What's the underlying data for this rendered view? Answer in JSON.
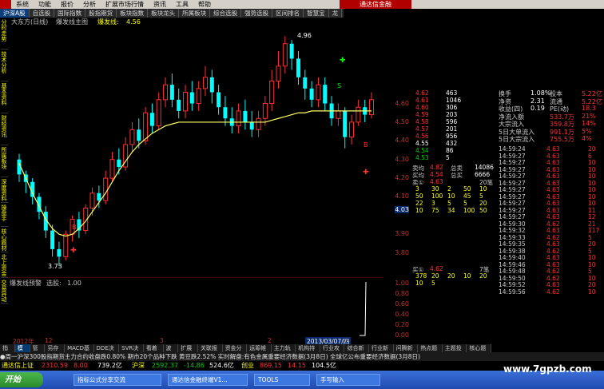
{
  "menubar": {
    "items": [
      "系统",
      "功能",
      "报价",
      "分析",
      "扩展市场行情",
      "资讯",
      "工具",
      "帮助"
    ]
  },
  "brand": "通达信金融",
  "toptabs": [
    "沪深A股",
    "自选股",
    "国际指数",
    "股指期货",
    "板块指数",
    "板块龙头",
    "所属板块",
    "综合选股",
    "强势选股",
    "区间排名",
    "智慧宝",
    "龙"
  ],
  "left_tabs": [
    "分时走势",
    "技术分析",
    "基本资料",
    "财经资讯",
    "所属板块",
    "深度资料",
    "操盘手",
    "核心题材",
    "北上资金",
    "交易异动"
  ],
  "chart": {
    "title": "大东方(日线)",
    "subtitle": "爆发线主图",
    "indicator_name": "爆发线:",
    "indicator_value": "4.56",
    "high_label": "4.96",
    "low_label": "3.73",
    "b_mark": "B",
    "s_mark": "S"
  },
  "chart_data": {
    "type": "candlestick",
    "ylim": [
      3.7,
      5.0
    ],
    "yticks": [
      "4.60",
      "4.50",
      "4.40",
      "4.30",
      "4.20",
      "4.10",
      "4.03",
      "3.90",
      "3.80"
    ],
    "indicator": {
      "label": "爆发线预警",
      "sub": "选股:",
      "value": "1.00",
      "ticks": [
        "1.00",
        "0.80",
        "0.60",
        "0.40",
        "0.20",
        "0.00"
      ]
    },
    "candles": [
      [
        4.3,
        4.22,
        4.33,
        4.18
      ],
      [
        4.22,
        4.18,
        4.24,
        4.12
      ],
      [
        4.18,
        4.1,
        4.2,
        4.06
      ],
      [
        4.1,
        4.02,
        4.12,
        3.98
      ],
      [
        4.02,
        3.92,
        4.05,
        3.88
      ],
      [
        3.92,
        3.82,
        3.95,
        3.78
      ],
      [
        3.82,
        3.78,
        3.86,
        3.73
      ],
      [
        3.78,
        3.9,
        3.92,
        3.76
      ],
      [
        3.9,
        3.98,
        4.0,
        3.86
      ],
      [
        3.98,
        3.92,
        4.02,
        3.88
      ],
      [
        3.92,
        4.04,
        4.06,
        3.9
      ],
      [
        4.04,
        4.12,
        4.15,
        4.0
      ],
      [
        4.12,
        4.08,
        4.16,
        4.04
      ],
      [
        4.08,
        4.2,
        4.24,
        4.06
      ],
      [
        4.2,
        4.3,
        4.34,
        4.18
      ],
      [
        4.3,
        4.26,
        4.36,
        4.22
      ],
      [
        4.26,
        4.38,
        4.42,
        4.24
      ],
      [
        4.38,
        4.46,
        4.5,
        4.34
      ],
      [
        4.46,
        4.4,
        4.52,
        4.36
      ],
      [
        4.4,
        4.55,
        4.58,
        4.38
      ],
      [
        4.55,
        4.48,
        4.6,
        4.44
      ],
      [
        4.48,
        4.62,
        4.66,
        4.46
      ],
      [
        4.62,
        4.7,
        4.74,
        4.58
      ],
      [
        4.7,
        4.62,
        4.76,
        4.58
      ],
      [
        4.62,
        4.56,
        4.68,
        4.52
      ],
      [
        4.56,
        4.66,
        4.7,
        4.52
      ],
      [
        4.66,
        4.6,
        4.72,
        4.56
      ],
      [
        4.6,
        4.68,
        4.72,
        4.56
      ],
      [
        4.68,
        4.74,
        4.8,
        4.64
      ],
      [
        4.74,
        4.66,
        4.78,
        4.6
      ],
      [
        4.66,
        4.58,
        4.7,
        4.54
      ],
      [
        4.58,
        4.52,
        4.64,
        4.48
      ],
      [
        4.52,
        4.48,
        4.58,
        4.44
      ],
      [
        4.48,
        4.56,
        4.6,
        4.44
      ],
      [
        4.56,
        4.5,
        4.62,
        4.46
      ],
      [
        4.5,
        4.46,
        4.56,
        4.42
      ],
      [
        4.46,
        4.52,
        4.56,
        4.42
      ],
      [
        4.52,
        4.6,
        4.64,
        4.48
      ],
      [
        4.6,
        4.72,
        4.78,
        4.56
      ],
      [
        4.72,
        4.8,
        4.88,
        4.68
      ],
      [
        4.8,
        4.92,
        4.96,
        4.76
      ],
      [
        4.92,
        4.84,
        4.94,
        4.78
      ],
      [
        4.84,
        4.74,
        4.88,
        4.7
      ],
      [
        4.74,
        4.68,
        4.78,
        4.62
      ],
      [
        4.68,
        4.62,
        4.72,
        4.58
      ],
      [
        4.62,
        4.7,
        4.74,
        4.58
      ],
      [
        4.7,
        4.6,
        4.74,
        4.56
      ],
      [
        4.6,
        4.52,
        4.64,
        4.48
      ],
      [
        4.52,
        4.56,
        4.6,
        4.48
      ],
      [
        4.56,
        4.42,
        4.58,
        4.36
      ],
      [
        4.42,
        4.5,
        4.54,
        4.38
      ],
      [
        4.5,
        4.58,
        4.62,
        4.48
      ],
      [
        4.58,
        4.54,
        4.62,
        4.5
      ],
      [
        4.54,
        4.62,
        4.66,
        4.52
      ]
    ],
    "line": [
      4.28,
      4.2,
      4.12,
      4.05,
      3.98,
      3.93,
      3.9,
      3.89,
      3.9,
      3.93,
      3.97,
      4.02,
      4.07,
      4.12,
      4.18,
      4.24,
      4.29,
      4.34,
      4.38,
      4.41,
      4.44,
      4.46,
      4.48,
      4.49,
      4.5,
      4.5,
      4.5,
      4.5,
      4.5,
      4.5,
      4.5,
      4.5,
      4.5,
      4.5,
      4.5,
      4.5,
      4.5,
      4.5,
      4.51,
      4.52,
      4.53,
      4.54,
      4.55,
      4.55,
      4.56,
      4.56,
      4.56,
      4.56,
      4.56,
      4.56,
      4.56,
      4.56,
      4.56,
      4.56
    ]
  },
  "dates": {
    "year": "2012年",
    "m1": "12",
    "m2": "3",
    "m3": "2",
    "current": "2013/03/07/四"
  },
  "bottomtabs": [
    "指标",
    "模板",
    "管理",
    "另存为",
    "MACD基本",
    "DDE决策",
    "SVR决策",
    "看着乌",
    "波段",
    "扩展区",
    "关联报价",
    "资金分析",
    "运筹帷幄",
    "主力轨迹",
    "机构持股",
    "行业攻略",
    "综合新闻",
    "行业新闻",
    "问腾新闻",
    "热点题材",
    "主题投资",
    "核心题材"
  ],
  "orderbook": {
    "sell": [
      [
        "4.62",
        "463"
      ],
      [
        "4.61",
        "1046"
      ],
      [
        "4.60",
        "306"
      ],
      [
        "4.59",
        "203"
      ],
      [
        "4.58",
        "596"
      ],
      [
        "4.57",
        "201"
      ],
      [
        "4.56",
        "956"
      ]
    ],
    "current": [
      "4.55",
      "432"
    ],
    "buy": [
      [
        "4.54",
        "86"
      ],
      [
        "4.53",
        "5"
      ]
    ],
    "tk": [
      [
        "卖均",
        "4.82",
        "总卖",
        "14086"
      ],
      [
        "买均",
        "4.54",
        "总买",
        "6666"
      ]
    ],
    "buy1": [
      "卖①",
      "4.63",
      "20笔"
    ],
    "grid": [
      [
        "3",
        "30",
        "2",
        "50",
        "10"
      ],
      [
        "50",
        "100",
        "10",
        "45",
        "5"
      ],
      [
        "22",
        "3",
        "5",
        "5",
        "20"
      ],
      [
        "10",
        "75",
        "34",
        "100",
        "50"
      ]
    ],
    "buy2": [
      "买①",
      "4.62",
      "7笔"
    ],
    "grid2": [
      [
        "378",
        "20",
        "20",
        "10",
        "20"
      ],
      [
        "10",
        "5",
        "",
        "",
        ""
      ]
    ]
  },
  "info": {
    "rows": [
      [
        "换手",
        "1.08%",
        "股本",
        "5.22亿"
      ],
      [
        "净资",
        "2.31",
        "流通",
        "5.22亿"
      ],
      [
        "收益(四)",
        "0.19",
        "PE(动)",
        "18.3"
      ],
      [
        "净流入额",
        "",
        "533.7万",
        "21%"
      ],
      [
        "大宗流入",
        "",
        "359.8万",
        "14%"
      ],
      [
        "5日大单流入",
        "",
        "991.1万",
        "5%"
      ],
      [
        "5日大宗流入",
        "",
        "755.5万",
        "4%"
      ]
    ],
    "trades": [
      [
        "14:59:24",
        "4.63",
        "20"
      ],
      [
        "14:59:27",
        "4.63",
        "6"
      ],
      [
        "14:59:27",
        "4.63",
        "10"
      ],
      [
        "14:59:27",
        "4.63",
        "10"
      ],
      [
        "14:59:27",
        "4.63",
        "10"
      ],
      [
        "14:59:27",
        "4.63",
        "10"
      ],
      [
        "14:59:27",
        "4.63",
        "10"
      ],
      [
        "14:59:27",
        "4.63",
        "10"
      ],
      [
        "14:59:27",
        "4.63",
        "10"
      ],
      [
        "14:59:27",
        "4.63",
        "11"
      ],
      [
        "14:59:27",
        "4.63",
        "12"
      ],
      [
        "14:59:30",
        "4.62",
        "21"
      ],
      [
        "14:59:32",
        "4.63",
        "117"
      ],
      [
        "14:59:33",
        "4.62",
        "5"
      ],
      [
        "14:59:35",
        "4.63",
        "20"
      ],
      [
        "14:59:38",
        "4.62",
        "5"
      ],
      [
        "14:59:40",
        "4.63",
        "10"
      ],
      [
        "14:59:46",
        "4.63",
        "10"
      ],
      [
        "14:59:48",
        "4.62",
        "5"
      ],
      [
        "14:59:50",
        "4.62",
        "10"
      ],
      [
        "14:59:52",
        "4.63",
        "20"
      ],
      [
        "14:59:56",
        "4.62",
        "10"
      ]
    ]
  },
  "ticker": "●周一沪深300股指期货主力合约收盘跌0.80%   期市20个品种下跌 黄豆跌2.52%   实时解盘:有色金属重要经济数据(3月8日)   全球亿公布重要经济数据(3月8日)",
  "status": {
    "idx1": "通达信上证",
    "v1": "2310.59",
    "c1": "8.00",
    "a1": "739.2亿",
    "idx2": "沪深",
    "v2": "2592.37",
    "c2": "-14.86",
    "a2": "524.6亿",
    "idx3": "创业",
    "v3": "869.15",
    "c3": "14.15",
    "a3": "104.5亿"
  },
  "taskbar": {
    "start": "开始",
    "tasks": [
      "指标公式分享交流",
      "通达信金融终端V1...",
      "TOOLS",
      "手写输入"
    ]
  },
  "watermark": "www.7gpzb.com"
}
